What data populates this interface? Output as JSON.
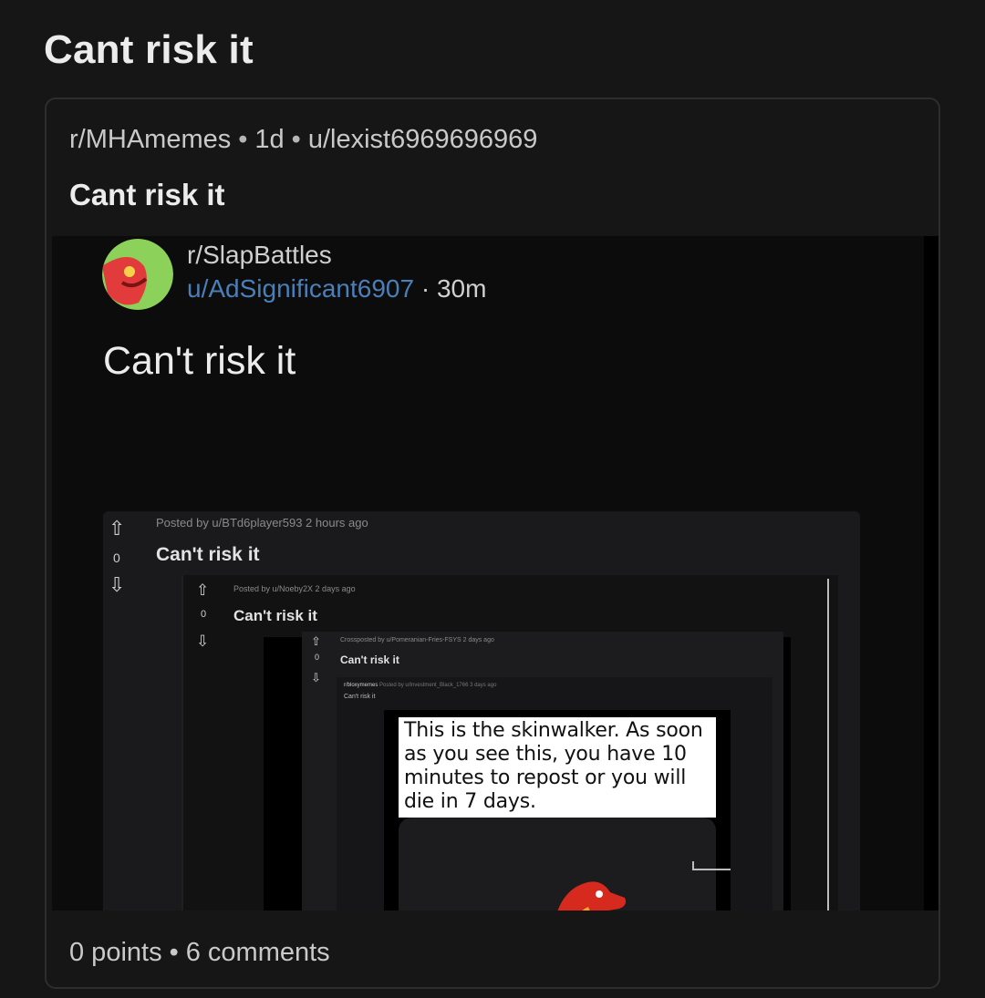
{
  "page": {
    "title": "Cant risk it"
  },
  "crosspost": {
    "subreddit": "r/MHAmemes",
    "age": "1d",
    "author": "u/lexist6969696969",
    "title": "Cant risk it",
    "points": "0 points",
    "comments": "6 comments"
  },
  "screenshot": {
    "subreddit": "r/SlapBattles",
    "user": "u/AdSignificant6907",
    "time": "30m",
    "title": "Can't risk it",
    "nested1": {
      "meta": "Posted by u/BTd6player593 2 hours ago",
      "vote_count": "0",
      "title": "Can't risk it"
    },
    "nested2": {
      "meta": "Posted by u/Noeby2X 2 days ago",
      "vote_count": "0",
      "title": "Can't risk it"
    },
    "nested3": {
      "meta": "Crossposted by u/Pomeranian-Fries-FSYS 2 days ago",
      "vote_count": "0",
      "title": "Can't risk it"
    },
    "nested4": {
      "sub": "r/bloxymemes",
      "meta": "Posted by u/Investment_Black_1766 3 days ago",
      "title": "Can't risk it"
    },
    "note": "This is the skinwalker. As soon as you see this, you have 10 minutes to repost or you will die in 7 days."
  },
  "colors": {
    "background": "#161617",
    "card_border": "#2d2d2f",
    "link_blue": "#4a7fb8"
  }
}
